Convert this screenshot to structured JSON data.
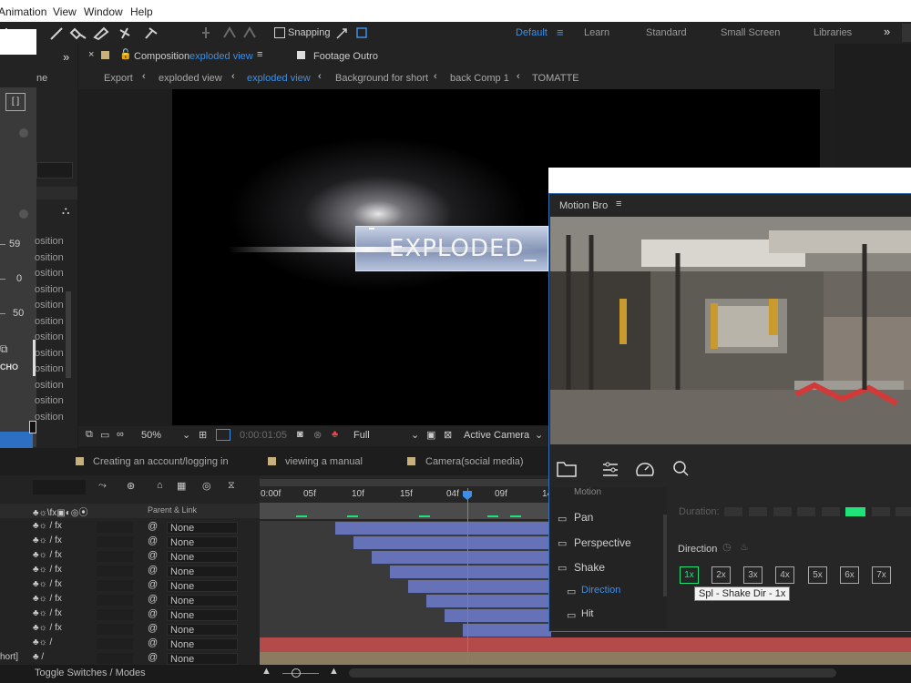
{
  "menu": [
    "Animation",
    "View",
    "Window",
    "Help"
  ],
  "toolbar": {
    "snapping_label": "Snapping"
  },
  "workspaces": {
    "default": "Default",
    "learn": "Learn",
    "standard": "Standard",
    "small_screen": "Small Screen",
    "libraries": "Libraries",
    "more": "»"
  },
  "left_panel": {
    "partial_label": "ne",
    "values": [
      "59",
      "0",
      "50"
    ],
    "position_rows": [
      "osition",
      "osition",
      "osition",
      "osition",
      "osition",
      "osition",
      "osition",
      "osition",
      "osition",
      "osition",
      "osition",
      "osition"
    ],
    "cho_label": "CHO",
    "expand_icon": "»"
  },
  "comp_panel": {
    "tab_prefix": "Composition",
    "tab_name": "exploded view",
    "footage_tab": "Footage Outro",
    "breadcrumbs": [
      "Export",
      "exploded view",
      "exploded view",
      "Background for short",
      "back Comp 1",
      "TOMATTE"
    ],
    "viewer_text": "EXPLODED_",
    "zoom": "50%",
    "timecode": "0:00:01:05",
    "resolution": "Full",
    "camera": "Active Camera"
  },
  "timeline_tabs": [
    "Creating an account/logging in",
    "viewing a manual",
    "Camera(social media)"
  ],
  "timeline": {
    "parent_header": "Parent & Link",
    "ruler": [
      "0:00f",
      "05f",
      "10f",
      "15f",
      "04f",
      "09f",
      "14"
    ],
    "parent_values": [
      "None",
      "None",
      "None",
      "None",
      "None",
      "None",
      "None",
      "None",
      "None",
      "None"
    ],
    "partial_layer_name": "hort]",
    "toggle_label": "Toggle Switches / Modes"
  },
  "motion_bro": {
    "title": "Motion Bro",
    "categories": [
      "Pan",
      "Perspective",
      "Shake"
    ],
    "subitems": [
      "Direction",
      "Hit"
    ],
    "partial_top": "Motion",
    "duration_label": "Duration:",
    "direction_label": "Direction",
    "direction_buttons": [
      "1x",
      "2x",
      "3x",
      "4x",
      "5x",
      "6x",
      "7x"
    ],
    "tooltip": "Spl - Shake Dir - 1x"
  },
  "colors": {
    "accent_blue": "#3c8fe8",
    "green": "#1fe27a",
    "layer_bar": "#6672b8",
    "red_track": "#b44a4a",
    "tan_track": "#8b7b5f"
  }
}
